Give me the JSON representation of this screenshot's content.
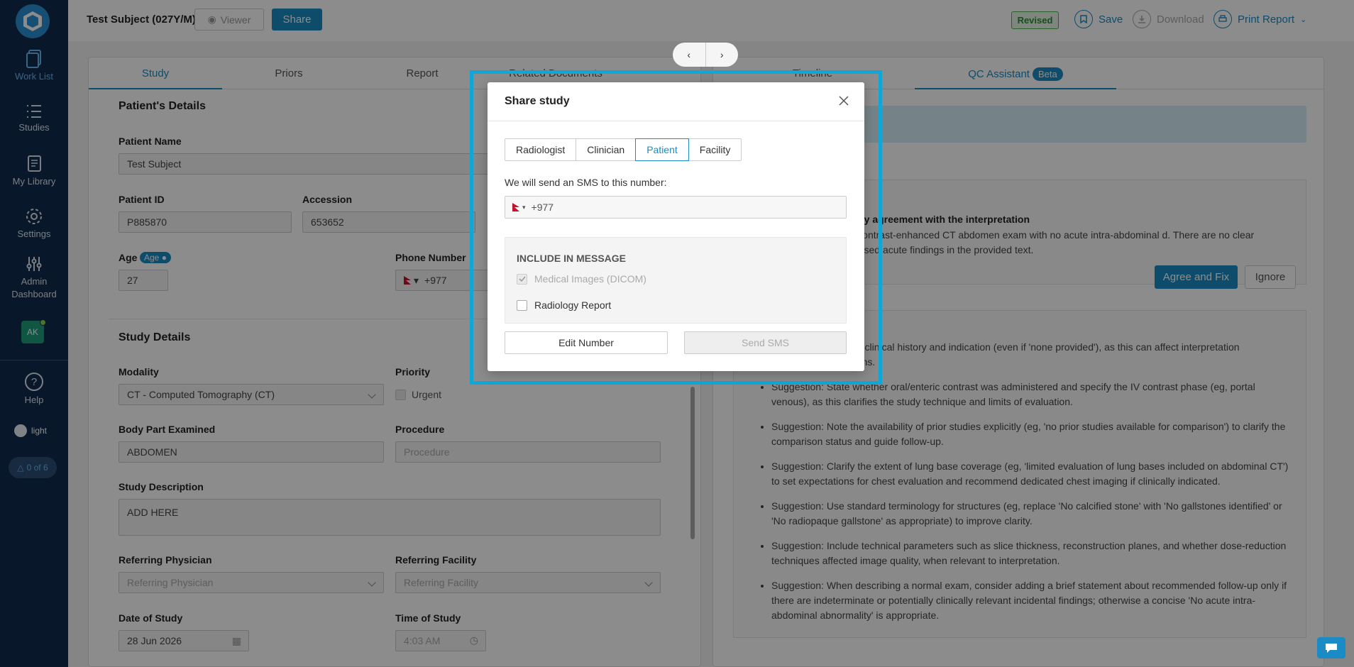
{
  "sidebar": {
    "items": [
      {
        "label": "Work List",
        "icon": "worklist-icon"
      },
      {
        "label": "Studies",
        "icon": "list-icon"
      },
      {
        "label": "My Library",
        "icon": "library-icon"
      },
      {
        "label": "Settings",
        "icon": "gear-icon"
      },
      {
        "label": "Admin Dashboard",
        "icon": "sliders-icon"
      }
    ],
    "avatar": "AK",
    "help": "Help",
    "theme": "light",
    "counter": "0 of 6"
  },
  "topbar": {
    "subject": "Test Subject (027Y/M)",
    "viewer": "Viewer",
    "share": "Share",
    "revised": "Revised",
    "save": "Save",
    "download": "Download",
    "print": "Print Report"
  },
  "left_tabs": [
    "Study",
    "Priors",
    "Report",
    "Related Documents"
  ],
  "right_tabs": {
    "timeline": "Timeline",
    "qc": "QC Assistant",
    "beta": "Beta"
  },
  "patient": {
    "section": "Patient's Details",
    "name_label": "Patient Name",
    "name": "Test Subject",
    "id_label": "Patient ID",
    "id": "P885870",
    "accession_label": "Accession",
    "accession": "653652",
    "age_label": "Age",
    "age_toggle": "Age",
    "age": "27",
    "phone_label": "Phone Number",
    "phone": "+977"
  },
  "study": {
    "section": "Study Details",
    "modality_label": "Modality",
    "modality": "CT - Computed Tomography (CT)",
    "priority_label": "Priority",
    "urgent": "Urgent",
    "body_part_label": "Body Part Examined",
    "body_part": "ABDOMEN",
    "procedure_label": "Procedure",
    "procedure_ph": "Procedure",
    "desc_label": "Study Description",
    "desc": "ADD HERE",
    "ref_phys_label": "Referring Physician",
    "ref_phys_ph": "Referring Physician",
    "ref_fac_label": "Referring Facility",
    "ref_fac_ph": "Referring Facility",
    "date_label": "Date of Study",
    "date": "28 Jun 2026",
    "time_label": "Time of Study",
    "time": "4:03 AM"
  },
  "qc": {
    "heading": "d, but this doesn't imply agreement with the interpretation",
    "text": "rt documents a normal contrast-enhanced CT abdomen exam with no acute intra-abdominal d. There are no clear misinterpretations or missed acute findings in the provided text.",
    "agree": "Agree and Fix",
    "ignore": "Ignore",
    "suggestions": [
      "t relevant clinical history and indication (even if 'none provided'), as this can affect interpretation mendations.",
      "Suggestion: State whether oral/enteric contrast was administered and specify the IV contrast phase (eg, portal venous), as this clarifies the study technique and limits of evaluation.",
      "Suggestion: Note the availability of prior studies explicitly (eg, 'no prior studies available for comparison') to clarify the comparison status and guide follow-up.",
      "Suggestion: Clarify the extent of lung base coverage (eg, 'limited evaluation of lung bases included on abdominal CT') to set expectations for chest evaluation and recommend dedicated chest imaging if clinically indicated.",
      "Suggestion: Use standard terminology for structures (eg, replace 'No calcified stone' with 'No gallstones identified' or 'No radiopaque gallstone' as appropriate) to improve clarity.",
      "Suggestion: Include technical parameters such as slice thickness, reconstruction planes, and whether dose-reduction techniques affected image quality, when relevant to interpretation.",
      "Suggestion: When describing a normal exam, consider adding a brief statement about recommended follow-up only if there are indeterminate or potentially clinically relevant incidental findings; otherwise a concise 'No acute intra-abdominal abnormality' is appropriate."
    ]
  },
  "modal": {
    "title": "Share study",
    "tabs": [
      "Radiologist",
      "Clinician",
      "Patient",
      "Facility"
    ],
    "active_tab": "Patient",
    "sms_label": "We will send an SMS to this number:",
    "phone": "+977",
    "include_title": "INCLUDE IN MESSAGE",
    "opt_dicom": "Medical Images (DICOM)",
    "opt_report": "Radiology Report",
    "edit": "Edit Number",
    "send": "Send SMS"
  },
  "colors": {
    "accent": "#1a8bc4",
    "sidebar": "#0f2a4c",
    "highlight": "#10a7d8"
  }
}
